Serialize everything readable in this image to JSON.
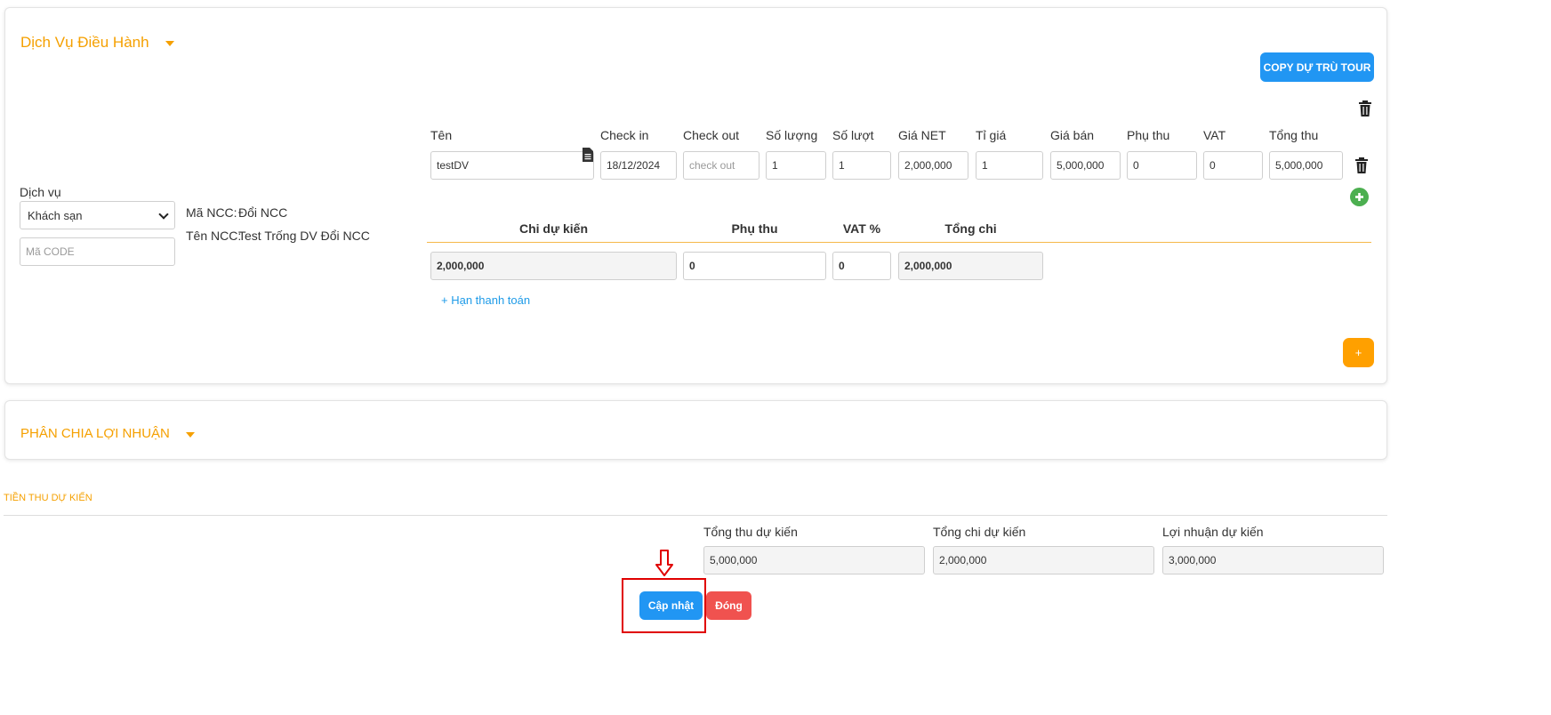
{
  "service_section": {
    "title": "Dịch Vụ Điều Hành",
    "copy_button": "COPY DỰ TRÙ TOUR",
    "dich_vu_label": "Dịch vụ",
    "dich_vu_value": "Khách sạn",
    "ma_code_placeholder": "Mã CODE",
    "ma_ncc_label": "Mã NCC:",
    "ma_ncc_value": "Đổi NCC",
    "ten_ncc_label": "Tên NCC:",
    "ten_ncc_value": "Test Trống DV Đổi NCC",
    "columns": {
      "ten": "Tên",
      "check_in": "Check in",
      "check_out": "Check out",
      "so_luong": "Số lượng",
      "so_luot": "Số lượt",
      "gia_net": "Giá NET",
      "ti_gia": "Tỉ giá",
      "gia_ban": "Giá bán",
      "phu_thu": "Phụ thu",
      "vat": "VAT",
      "tong_thu": "Tổng thu"
    },
    "row": {
      "ten": "testDV",
      "check_in": "18/12/2024",
      "check_out_placeholder": "check out",
      "so_luong": "1",
      "so_luot": "1",
      "gia_net": "2,000,000",
      "ti_gia": "1",
      "gia_ban": "5,000,000",
      "phu_thu": "0",
      "vat": "0",
      "tong_thu": "5,000,000"
    },
    "cost_columns": {
      "chi_du_kien": "Chi dự kiến",
      "phu_thu": "Phụ thu",
      "vat_percent": "VAT %",
      "tong_chi": "Tổng chi"
    },
    "cost_row": {
      "chi_du_kien": "2,000,000",
      "phu_thu": "0",
      "vat_percent": "0",
      "tong_chi": "2,000,000"
    },
    "payment_link": "+ Hạn thanh toán",
    "add_button": "+"
  },
  "profit_section": {
    "title": "PHÂN CHIA LỢI NHUẬN"
  },
  "estimate_section": {
    "title": "TIỀN THU DỰ KIẾN",
    "tong_thu_label": "Tổng thu dự kiến",
    "tong_thu_value": "5,000,000",
    "tong_chi_label": "Tổng chi dự kiến",
    "tong_chi_value": "2,000,000",
    "loi_nhuan_label": "Lợi nhuận dự kiến",
    "loi_nhuan_value": "3,000,000"
  },
  "actions": {
    "update": "Cập nhật",
    "close": "Đóng"
  },
  "colors": {
    "accent_orange": "#f5a000",
    "primary_blue": "#2196f3",
    "danger_red": "#f0524f",
    "success_green": "#4caf50",
    "highlight_red": "#e00000"
  }
}
